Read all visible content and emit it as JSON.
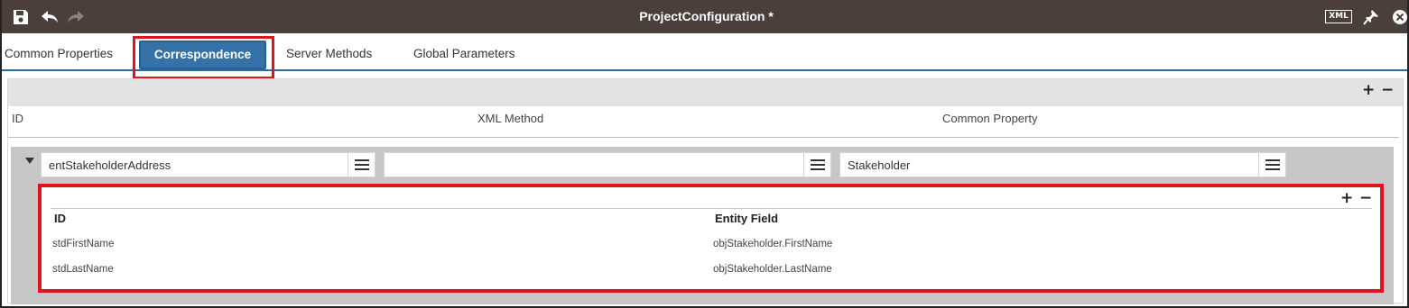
{
  "window": {
    "title": "ProjectConfiguration *",
    "icons": {
      "save": "save-icon",
      "undo": "undo-icon",
      "redo": "redo-icon",
      "xml": "XML",
      "pin": "pin-icon",
      "close": "close-icon"
    }
  },
  "tabs": [
    {
      "label": "Common Properties",
      "active": false
    },
    {
      "label": "Correspondence",
      "active": true
    },
    {
      "label": "Server Methods",
      "active": false
    },
    {
      "label": "Global Parameters",
      "active": false
    }
  ],
  "grid": {
    "columns": [
      "ID",
      "XML Method",
      "Common Property"
    ],
    "row": {
      "id_value": "entStakeholderAddress",
      "xml_method_value": "",
      "common_property_value": "Stakeholder"
    },
    "add_symbol": "+",
    "remove_symbol": "−"
  },
  "sub_grid": {
    "columns": [
      "ID",
      "Entity Field"
    ],
    "rows": [
      {
        "id": "stdFirstName",
        "entity_field": "objStakeholder.FirstName"
      },
      {
        "id": "stdLastName",
        "entity_field": "objStakeholder.LastName"
      }
    ],
    "add_symbol": "+",
    "remove_symbol": "−"
  },
  "colors": {
    "titlebar": "#4a3f3b",
    "active_tab": "#3472a8",
    "highlight": "#e0141f",
    "row_area": "#c7c7c7"
  }
}
